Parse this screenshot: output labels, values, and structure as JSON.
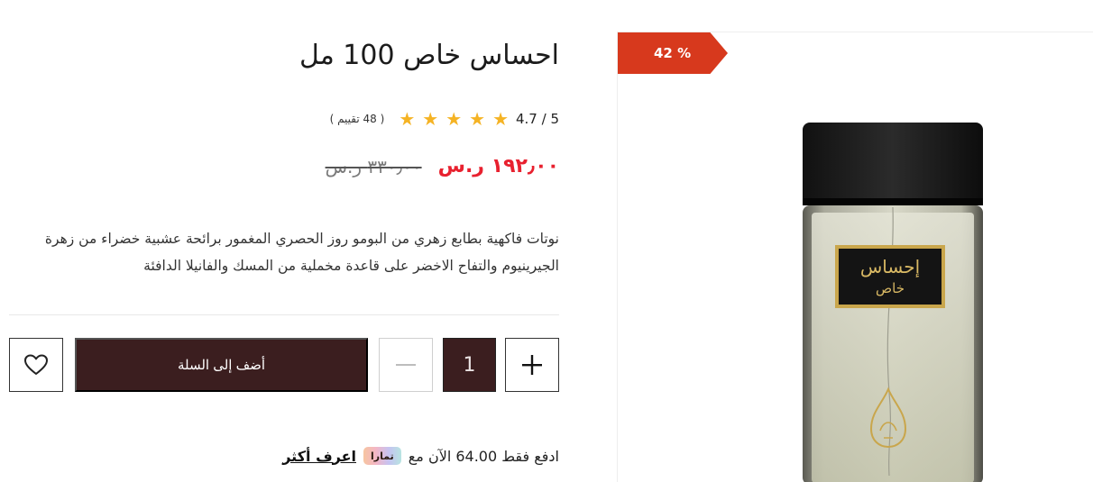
{
  "product": {
    "title": "احساس خاص 100 مل",
    "rating_score": "4.7 / 5",
    "rating_count": "( 48 تقييم )",
    "rating_value": 4.7,
    "rating_max": 5,
    "price_new": "١٩٢٫٠٠ ر.س",
    "price_old": "٣٣٠٫٠٠ ر.س",
    "description": "نوتات فاكهية بطابع زهري من البومو روز الحصري المغمور برائحة عشبية خضراء من زهرة الجيرينيوم والتفاح الاخضر على قاعدة مخملية من المسك والفانيلا الدافئة",
    "discount_badge": "42 %",
    "label_line1": "إحساس",
    "label_line2": "خاص"
  },
  "actions": {
    "add_to_cart": "أضف إلى السلة",
    "quantity": "1"
  },
  "installment": {
    "text": "ادفع فقط 64.00 الآن مع",
    "provider": "تمارا",
    "learn_more": "اعرف أكثر"
  },
  "colors": {
    "accent_dark": "#3b1e1f",
    "price_red": "#e8212f",
    "discount_bg": "#d7391d",
    "star": "#f5b324"
  },
  "icons": [
    "heart-icon",
    "minus-icon",
    "plus-icon",
    "star-icon"
  ]
}
